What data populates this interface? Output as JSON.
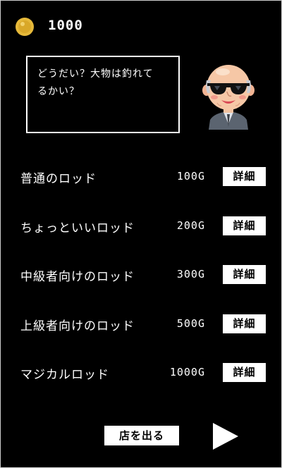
{
  "header": {
    "coins": "1000",
    "coin_color": "#e6b93a"
  },
  "dialog": {
    "line1": "どうだい？大物は釣れて",
    "line2": "るかい？"
  },
  "shopkeeper": {
    "icon": "old-man-sunglasses-icon"
  },
  "rods": [
    {
      "name": "普通のロッド",
      "price": "100G",
      "detail": "詳細"
    },
    {
      "name": "ちょっといいロッド",
      "price": "200G",
      "detail": "詳細"
    },
    {
      "name": "中級者向けのロッド",
      "price": "300G",
      "detail": "詳細"
    },
    {
      "name": "上級者向けのロッド",
      "price": "500G",
      "detail": "詳細"
    },
    {
      "name": "マジカルロッド",
      "price": "1000G",
      "detail": "詳細"
    }
  ],
  "footer": {
    "leave_label": "店を出る",
    "next_icon": "play-arrow-icon"
  },
  "colors": {
    "background": "#000000",
    "text": "#ffffff",
    "button_bg": "#ffffff",
    "button_text": "#000000"
  }
}
